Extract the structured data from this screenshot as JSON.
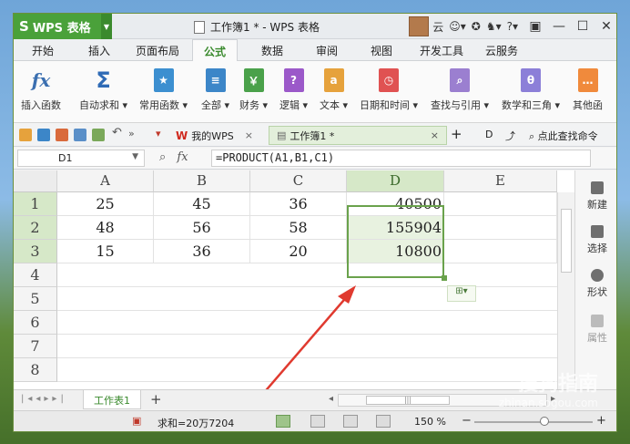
{
  "app": {
    "name": "WPS 表格",
    "logo": "S",
    "doc_title": "工作簿1 * - WPS 表格",
    "user": "云"
  },
  "menu": {
    "tabs": [
      "开始",
      "插入",
      "页面布局",
      "公式",
      "数据",
      "审阅",
      "视图",
      "开发工具",
      "云服务"
    ],
    "active": "公式"
  },
  "ribbon": {
    "buttons": [
      {
        "label": "插入函数",
        "icon": "fx-icon",
        "color": "#3b6fb0"
      },
      {
        "label": "自动求和",
        "icon": "sigma-icon",
        "color": "#2f6bb6"
      },
      {
        "label": "常用函数",
        "icon": "star-icon",
        "color": "#3c8fd0"
      },
      {
        "label": "全部",
        "icon": "list-icon",
        "color": "#3c86c8"
      },
      {
        "label": "财务",
        "icon": "finance-icon",
        "color": "#4aa14a"
      },
      {
        "label": "逻辑",
        "icon": "question-icon",
        "color": "#9b59c9"
      },
      {
        "label": "文本",
        "icon": "text-icon",
        "color": "#e6a23c"
      },
      {
        "label": "日期和时间",
        "icon": "clock-icon",
        "color": "#e05252"
      },
      {
        "label": "查找与引用",
        "icon": "search-icon",
        "color": "#9b7fd0"
      },
      {
        "label": "数学和三角",
        "icon": "theta-icon",
        "color": "#8c7fd8"
      },
      {
        "label": "其他函",
        "icon": "more-icon",
        "color": "#f08a3c"
      }
    ]
  },
  "quickbar": {
    "tab_wps": "我的WPS",
    "tab_doc": "工作簿1 *",
    "find_cmd": "点此查找命令"
  },
  "formula_bar": {
    "name_box": "D1",
    "formula": "=PRODUCT(A1,B1,C1)"
  },
  "sheet": {
    "columns": [
      "A",
      "B",
      "C",
      "D",
      "E"
    ],
    "rows": [
      "1",
      "2",
      "3",
      "4",
      "5",
      "6",
      "7",
      "8"
    ],
    "cells": [
      [
        "25",
        "45",
        "36",
        "40500",
        ""
      ],
      [
        "48",
        "56",
        "58",
        "155904",
        ""
      ],
      [
        "15",
        "36",
        "20",
        "10800",
        ""
      ]
    ],
    "selected_column": "D"
  },
  "side_pane": {
    "items": [
      "新建",
      "选择",
      "形状",
      "属性"
    ]
  },
  "sheet_tabs": {
    "active": "工作表1"
  },
  "status": {
    "sum": "求和=20万7204",
    "zoom": "150 %"
  },
  "watermark": {
    "line1": "搜狗指南",
    "line2": "zhinan.sogou.com"
  }
}
